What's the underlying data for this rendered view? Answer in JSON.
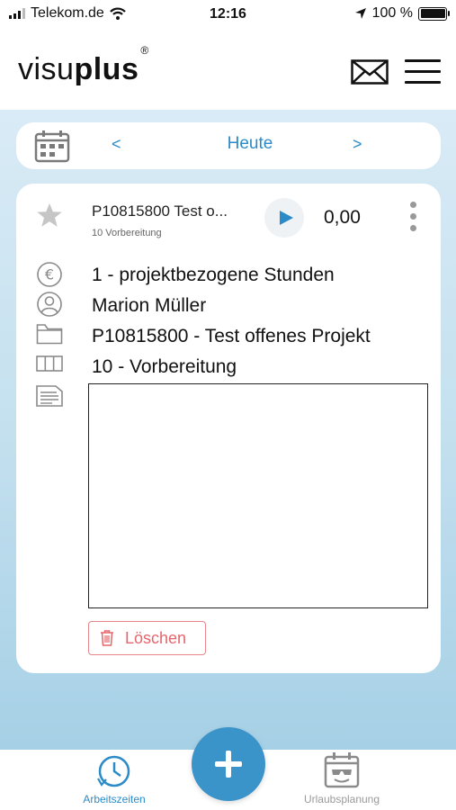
{
  "status_bar": {
    "carrier": "Telekom.de",
    "time": "12:16",
    "battery": "100 %",
    "icons": [
      "signal-icon",
      "wifi-icon",
      "location-arrow-icon",
      "battery-icon"
    ]
  },
  "header": {
    "logo_light": "visu",
    "logo_bold": "plus",
    "logo_mark": "®",
    "icons": [
      "mail-icon",
      "hamburger-menu-icon"
    ]
  },
  "date_nav": {
    "prev": "<",
    "today": "Heute",
    "next": ">",
    "icon": "calendar-icon"
  },
  "entry": {
    "title": "P10815800  Test o...",
    "subtitle": "10  Vorbereitung",
    "hours": "0,00",
    "rows": [
      {
        "icon": "euro-icon",
        "text": "1 - projektbezogene Stunden"
      },
      {
        "icon": "user-icon",
        "text": "Marion Müller"
      },
      {
        "icon": "folder-icon",
        "text": "P10815800 - Test offenes Projekt"
      },
      {
        "icon": "columns-icon",
        "text": "10 - Vorbereitung"
      },
      {
        "icon": "document-icon",
        "text": ""
      }
    ],
    "note_value": "",
    "delete_label": "Löschen"
  },
  "tabbar": {
    "tab_time_label": "Arbeitszeiten",
    "tab_vacation_label": "Urlaubsplanung",
    "fab_icon": "plus-icon"
  },
  "colors": {
    "accent": "#2b8bc8",
    "fab": "#3a93c9",
    "delete": "#e5666c",
    "inactive": "#9a9a9a"
  }
}
